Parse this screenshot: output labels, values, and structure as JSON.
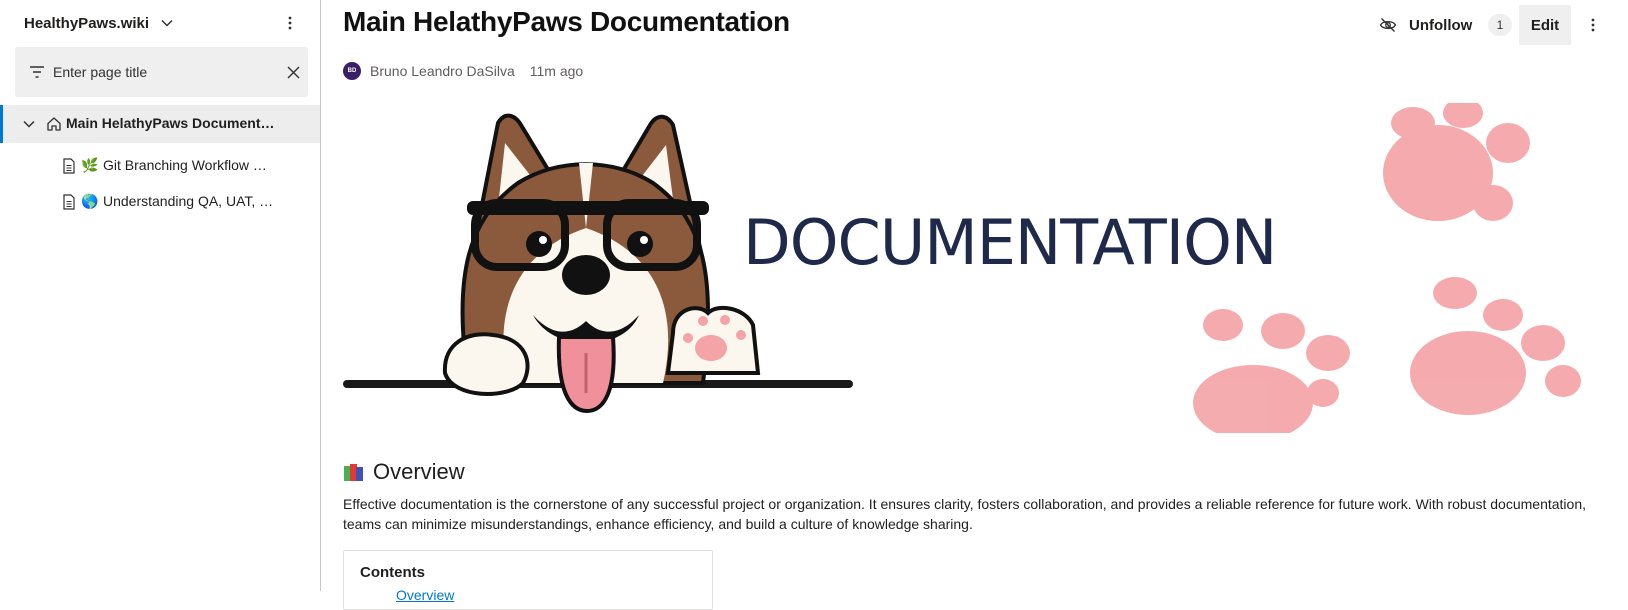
{
  "sidebar": {
    "wiki_title": "HealthyPaws.wiki",
    "filter": {
      "placeholder": "Enter page title",
      "value": ""
    },
    "tree": {
      "root_label": "Main HelathyPaws Document…",
      "children": [
        {
          "emoji": "🌿",
          "label": "Git Branching Workflow …"
        },
        {
          "emoji": "🌎",
          "label": "Understanding QA, UAT, …"
        }
      ]
    }
  },
  "page": {
    "title": "Main HelathyPaws Documentation",
    "author_initials": "BD",
    "author": "Bruno Leandro DaSilva",
    "time": "11m ago",
    "unfollow_label": "Unfollow",
    "follow_count": "1",
    "edit_label": "Edit",
    "banner_text": "DOCUMENTATION",
    "overview_heading": "Overview",
    "overview_text": "Effective documentation is the cornerstone of any successful project or organization. It ensures clarity, fosters collaboration, and provides a reliable reference for future work. With robust documentation, teams can minimize misunderstandings, enhance efficiency, and build a culture of knowledge sharing.",
    "contents_title": "Contents",
    "contents_first_link": "Overview"
  },
  "colors": {
    "accent": "#0078d4",
    "banner_text": "#1f2a4a",
    "paw_pink": "#f4a3a6",
    "dog_brown": "#8b5a3c"
  },
  "icons": [
    "chevron-down-icon",
    "more-vertical-icon",
    "filter-icon",
    "close-icon",
    "home-icon",
    "document-icon",
    "unfollow-eye-icon",
    "books-icon"
  ]
}
